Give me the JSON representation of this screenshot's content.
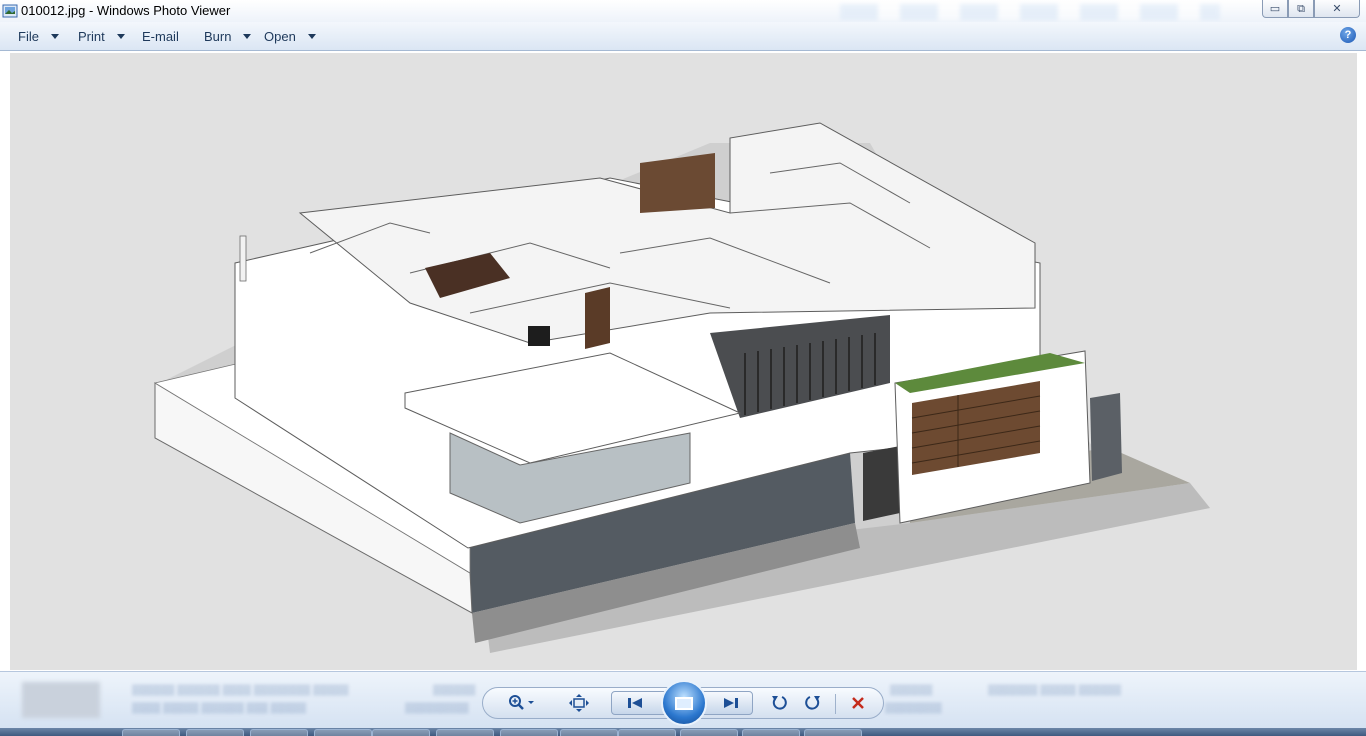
{
  "window": {
    "title": "010012.jpg - Windows Photo Viewer",
    "minimize_glyph": "▭",
    "maximize_glyph": "⧉",
    "close_glyph": "✕"
  },
  "menu": {
    "items": [
      {
        "label": "File",
        "has_dropdown": true
      },
      {
        "label": "Print",
        "has_dropdown": true
      },
      {
        "label": "E-mail",
        "has_dropdown": false
      },
      {
        "label": "Burn",
        "has_dropdown": true
      },
      {
        "label": "Open",
        "has_dropdown": true
      }
    ],
    "help_glyph": "?"
  },
  "image": {
    "description_icon": "image-icon",
    "background_color": "#e1e1e1"
  },
  "controls": {
    "zoom_icon": "zoom-icon",
    "actual_size_icon": "fit-to-window-icon",
    "previous_icon": "previous-icon",
    "slideshow_icon": "slideshow-icon",
    "next_icon": "next-icon",
    "rotate_ccw_icon": "rotate-counterclockwise-icon",
    "rotate_cw_icon": "rotate-clockwise-icon",
    "delete_icon": "delete-icon",
    "delete_color": "#c42b1c",
    "accent_color": "#1d4f96"
  }
}
